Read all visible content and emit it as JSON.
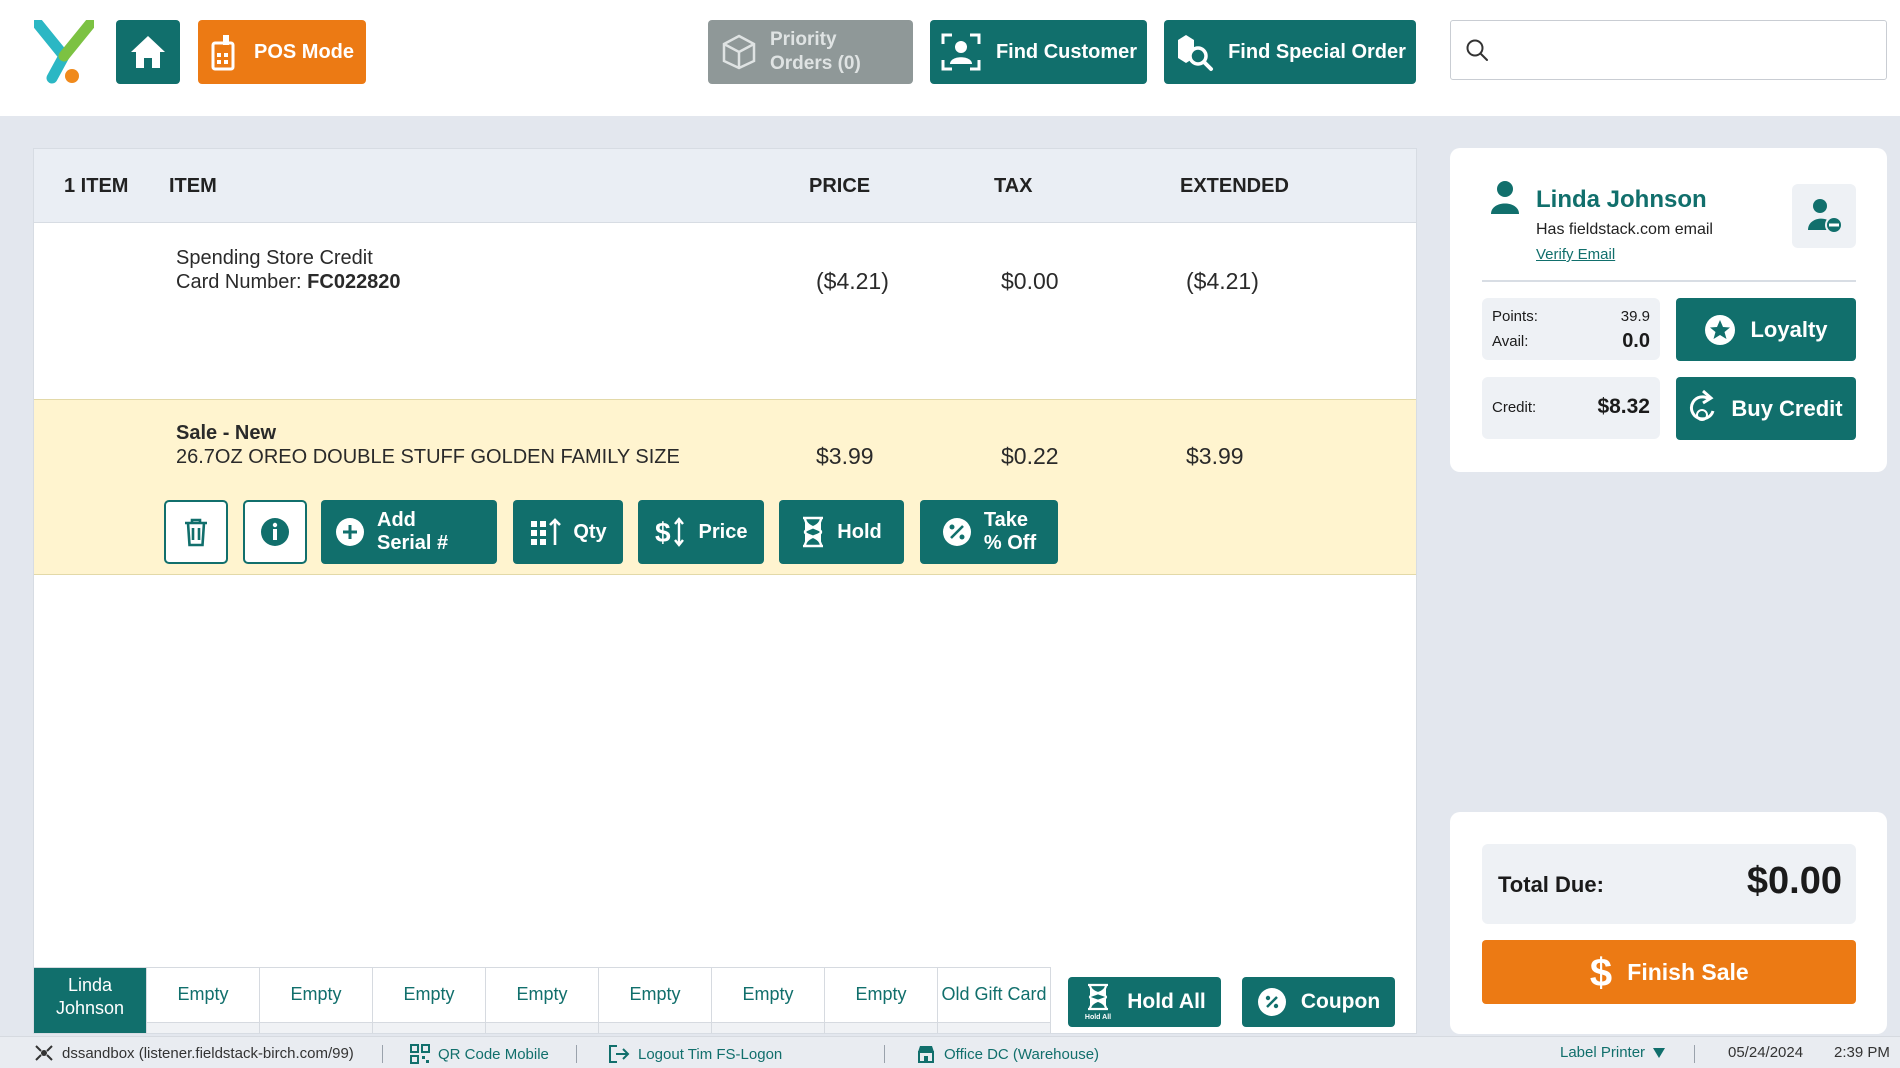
{
  "header": {
    "pos_mode_label": "POS Mode",
    "priority_orders_line1": "Priority",
    "priority_orders_line2": "Orders (0)",
    "find_customer_label": "Find Customer",
    "find_special_order_label": "Find Special Order",
    "search_placeholder": ""
  },
  "cart": {
    "columns": {
      "count": "1 ITEM",
      "item": "ITEM",
      "price": "PRICE",
      "tax": "TAX",
      "extended": "EXTENDED"
    },
    "rows": [
      {
        "line1": "Spending Store Credit",
        "card_label": "Card Number: ",
        "card_number": "FC022820",
        "price": "($4.21)",
        "tax": "$0.00",
        "extended": "($4.21)"
      },
      {
        "type": "Sale - New",
        "description": "26.7OZ OREO DOUBLE STUFF GOLDEN FAMILY SIZE",
        "price": "$3.99",
        "tax": "$0.22",
        "extended": "$3.99"
      }
    ],
    "actions": {
      "add_serial_line1": "Add",
      "add_serial_line2": "Serial #",
      "qty": "Qty",
      "price": "Price",
      "hold": "Hold",
      "take_off_line1": "Take",
      "take_off_line2": "% Off"
    },
    "tabs": [
      {
        "line1": "Linda",
        "line2": "Johnson",
        "active": true
      },
      {
        "label": "Empty"
      },
      {
        "label": "Empty"
      },
      {
        "label": "Empty"
      },
      {
        "label": "Empty"
      },
      {
        "label": "Empty"
      },
      {
        "label": "Empty"
      },
      {
        "label": "Empty"
      },
      {
        "label": "Old Gift Card"
      }
    ],
    "hold_all_label": "Hold All",
    "hold_all_icon_caption": "Hold All",
    "coupon_label": "Coupon"
  },
  "customer": {
    "name": "Linda Johnson",
    "email_note": "Has fieldstack.com email",
    "verify_link": "Verify Email",
    "points_label": "Points:",
    "points_value": "39.9",
    "avail_label": "Avail:",
    "avail_value": "0.0",
    "credit_label": "Credit:",
    "credit_value": "$8.32",
    "loyalty_label": "Loyalty",
    "buy_credit_label": "Buy Credit"
  },
  "totals": {
    "total_due_label": "Total Due:",
    "total_due_value": "$0.00",
    "finish_sale_label": "Finish Sale"
  },
  "status": {
    "environment": "dssandbox (listener.fieldstack-birch.com/99)",
    "qr_code": "QR Code Mobile",
    "logout": "Logout Tim FS-Logon",
    "location": "Office DC (Warehouse)",
    "printer": "Label Printer",
    "date": "05/24/2024",
    "time": "2:39 PM"
  },
  "colors": {
    "primary": "#116f6c",
    "accent": "#ec7a14",
    "highlight_row": "#fff4cf",
    "background": "#e3e7ee"
  },
  "icons": [
    "app-logo",
    "home-icon",
    "pos-terminal-icon",
    "box-icon",
    "find-customer-icon",
    "find-order-icon",
    "search-icon",
    "trash-icon",
    "info-icon",
    "plus-circle-icon",
    "qty-icon",
    "price-icon",
    "hourglass-icon",
    "percent-icon",
    "coupon-icon",
    "user-icon",
    "remove-user-icon",
    "star-icon",
    "refresh-credit-icon",
    "dollar-icon",
    "network-icon",
    "qr-icon",
    "logout-icon",
    "store-icon",
    "dropdown-icon"
  ]
}
